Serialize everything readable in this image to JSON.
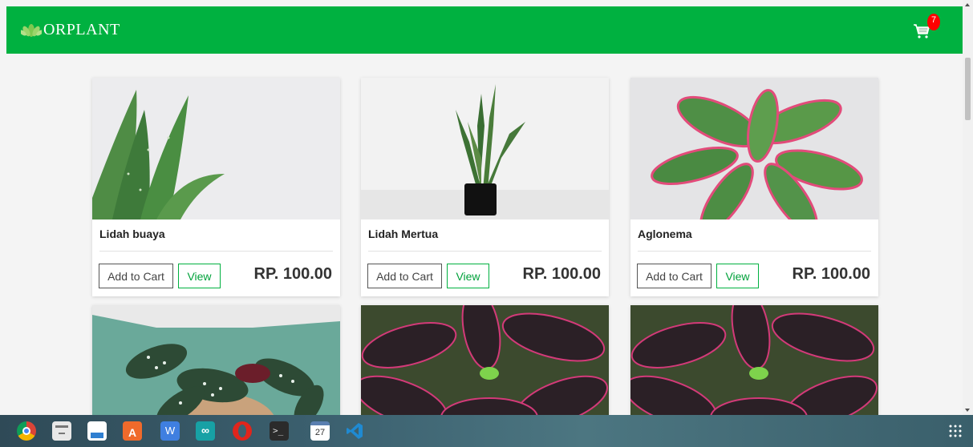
{
  "header": {
    "brand": "ORPLANT",
    "brand_color": "#00b140",
    "cart_icon": "shopping-cart-icon",
    "cart_count": "7"
  },
  "products": [
    {
      "name": "Lidah buaya",
      "price": "RP. 100.00",
      "add_label": "Add to Cart",
      "view_label": "View"
    },
    {
      "name": "Lidah Mertua",
      "price": "RP. 100.00",
      "add_label": "Add to Cart",
      "view_label": "View"
    },
    {
      "name": "Aglonema",
      "price": "RP. 100.00",
      "add_label": "Add to Cart",
      "view_label": "View"
    },
    {
      "name": "",
      "price": "",
      "add_label": "",
      "view_label": ""
    },
    {
      "name": "",
      "price": "",
      "add_label": "",
      "view_label": ""
    },
    {
      "name": "",
      "price": "",
      "add_label": "",
      "view_label": ""
    }
  ],
  "taskbar": {
    "apps": [
      "chrome-icon",
      "file-manager-icon",
      "text-editor-icon",
      "app-store-icon",
      "word-icon",
      "arduino-icon",
      "opera-icon",
      "terminal-icon",
      "calendar-icon",
      "vscode-icon"
    ],
    "calendar_day": "27",
    "app_grid_icon": "app-grid-icon"
  }
}
